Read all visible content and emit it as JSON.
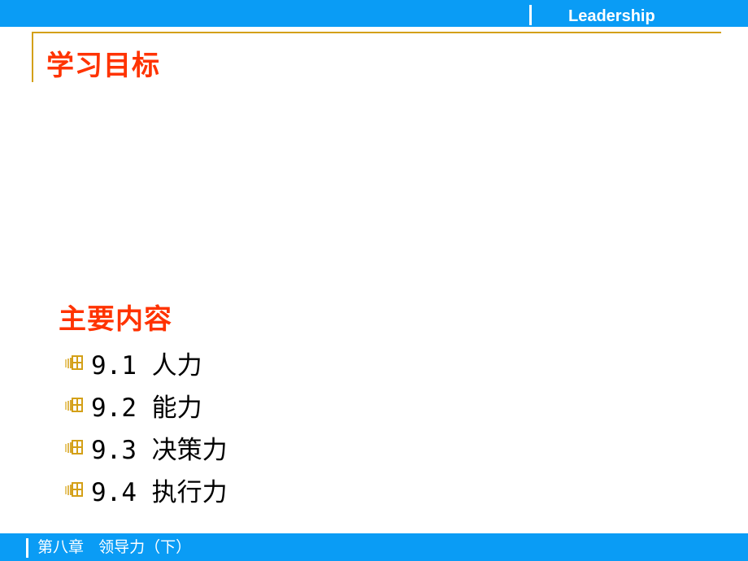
{
  "header": {
    "brand": "Leadership",
    "bar_color": "#0a9cf5"
  },
  "title": "学习目标",
  "section_title": "主要内容",
  "items": [
    {
      "label": "9.1 人力"
    },
    {
      "label": "9.2 能力"
    },
    {
      "label": "9.3 决策力"
    },
    {
      "label": "9.4 执行力"
    }
  ],
  "bullet_icon": "window-bullet-icon",
  "footer": {
    "chapter": "第八章   领导力（下）"
  },
  "colors": {
    "accent_red": "#ff3300",
    "gold": "#d4a017"
  }
}
